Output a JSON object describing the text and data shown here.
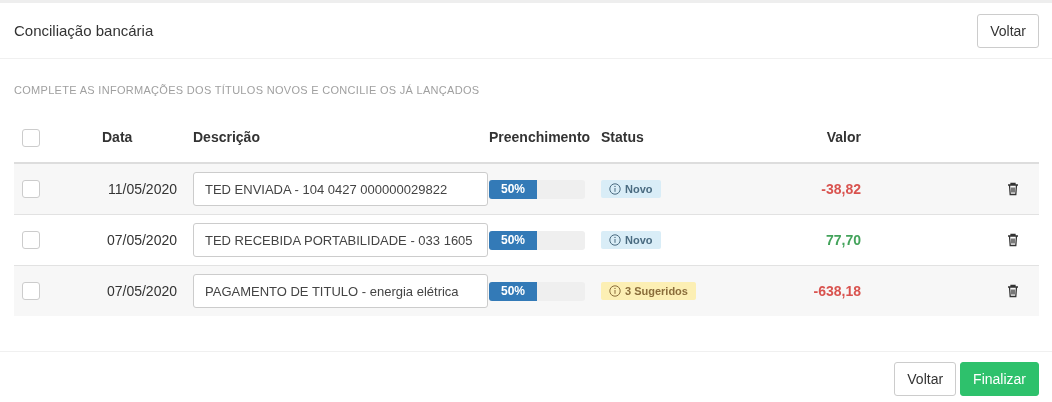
{
  "header": {
    "title": "Conciliação bancária",
    "back_button": "Voltar"
  },
  "instruction": "COMPLETE AS INFORMAÇÕES DOS TÍTULOS NOVOS E CONCILIE OS JÁ LANÇADOS",
  "table": {
    "select_all": {
      "checked": false
    },
    "columns": [
      "Data",
      "Descrição",
      "Preenchimento",
      "Status",
      "Valor"
    ],
    "rows": [
      {
        "checked": false,
        "date": "11/05/2020",
        "description": "TED ENVIADA - 104 0427 000000029822",
        "level": 0.5,
        "fill_label": "50%",
        "status": {
          "kind": "new",
          "label": "Novo"
        },
        "value": "-38,82",
        "color": "#d9534f"
      },
      {
        "checked": false,
        "date": "07/05/2020",
        "description": "TED RECEBIDA PORTABILIDADE - 033 1605",
        "level": 0.5,
        "fill_label": "50%",
        "status": {
          "kind": "new",
          "label": "Novo"
        },
        "value": "77,70",
        "color": "#43a35b"
      },
      {
        "checked": false,
        "date": "07/05/2020",
        "description": "PAGAMENTO DE TITULO - energia elétrica",
        "level": 0.5,
        "fill_label": "50%",
        "status": {
          "kind": "suggested",
          "label": "3 Sugeridos"
        },
        "value": "-638,18",
        "color": "#d9534f"
      }
    ]
  },
  "footer": {
    "buttons": [
      {
        "label": "Voltar",
        "kind": "secondary"
      },
      {
        "label": "Finalizar",
        "kind": "primary"
      }
    ]
  }
}
